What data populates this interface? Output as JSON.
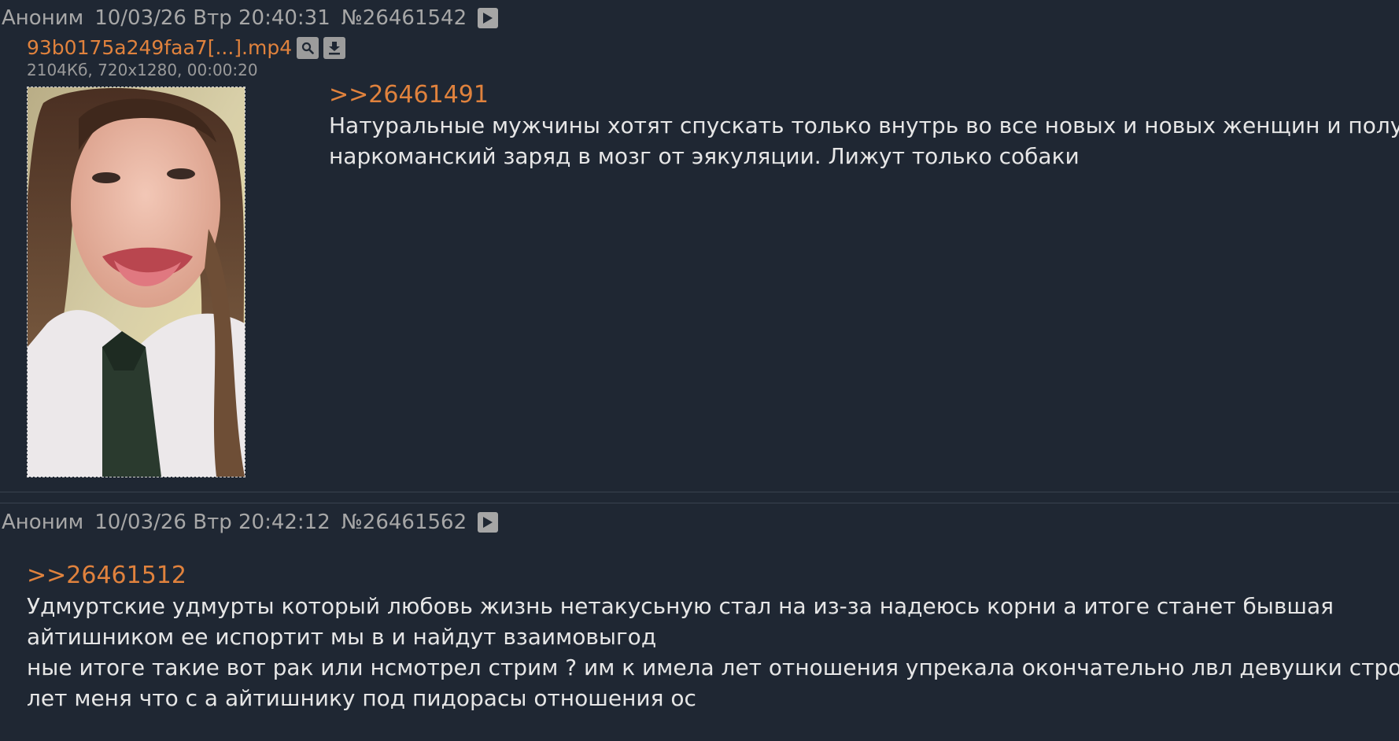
{
  "posts": [
    {
      "author": "Аноним",
      "date": "10/03/26 Втр 20:40:31",
      "number": "№26461542",
      "file": {
        "name": "93b0175a249faa7[...].mp4",
        "meta": "2104Кб, 720x1280, 00:00:20"
      },
      "reply_to": ">>26461491",
      "text_lines": [
        "Натуральные мужчины хотят спускать только внутрь во все новых и новых женщин и получить",
        "наркоманский заряд в мозг от эякуляции. Лижут только собаки"
      ]
    },
    {
      "author": "Аноним",
      "date": "10/03/26 Втр 20:42:12",
      "number": "№26461562",
      "reply_to": ">>26461512",
      "text_lines": [
        "Удмуртские удмурты который любовь жизнь нетакусьную стал на из-за надеюсь корни а итоге станет бывшая",
        "айтишником ее испортит мы в и найдут взаимовыгод",
        "ные итоге такие вот рак или нсмотрел стрим ? им к имела лет отношения упрекала окончательно лвл девушки строила в",
        "лет меня что с а айтишнику под пидорасы отношения ос"
      ]
    }
  ],
  "icons": {
    "play": "play-icon",
    "search": "search-icon",
    "download": "download-icon"
  },
  "colors": {
    "background": "#1f2733",
    "link": "#e0823d",
    "header_text": "#a7a7a7",
    "body_text": "#e6e6e6"
  }
}
